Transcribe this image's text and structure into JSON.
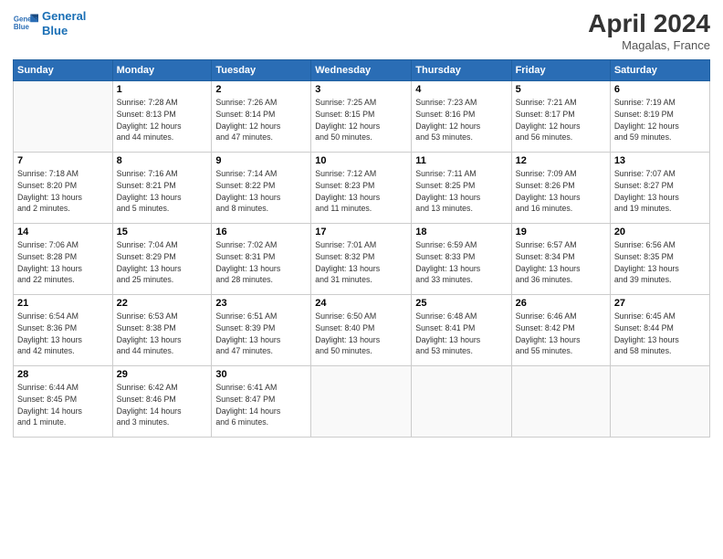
{
  "header": {
    "logo_line1": "General",
    "logo_line2": "Blue",
    "title": "April 2024",
    "location": "Magalas, France"
  },
  "weekdays": [
    "Sunday",
    "Monday",
    "Tuesday",
    "Wednesday",
    "Thursday",
    "Friday",
    "Saturday"
  ],
  "weeks": [
    [
      {
        "day": "",
        "info": ""
      },
      {
        "day": "1",
        "info": "Sunrise: 7:28 AM\nSunset: 8:13 PM\nDaylight: 12 hours\nand 44 minutes."
      },
      {
        "day": "2",
        "info": "Sunrise: 7:26 AM\nSunset: 8:14 PM\nDaylight: 12 hours\nand 47 minutes."
      },
      {
        "day": "3",
        "info": "Sunrise: 7:25 AM\nSunset: 8:15 PM\nDaylight: 12 hours\nand 50 minutes."
      },
      {
        "day": "4",
        "info": "Sunrise: 7:23 AM\nSunset: 8:16 PM\nDaylight: 12 hours\nand 53 minutes."
      },
      {
        "day": "5",
        "info": "Sunrise: 7:21 AM\nSunset: 8:17 PM\nDaylight: 12 hours\nand 56 minutes."
      },
      {
        "day": "6",
        "info": "Sunrise: 7:19 AM\nSunset: 8:19 PM\nDaylight: 12 hours\nand 59 minutes."
      }
    ],
    [
      {
        "day": "7",
        "info": "Sunrise: 7:18 AM\nSunset: 8:20 PM\nDaylight: 13 hours\nand 2 minutes."
      },
      {
        "day": "8",
        "info": "Sunrise: 7:16 AM\nSunset: 8:21 PM\nDaylight: 13 hours\nand 5 minutes."
      },
      {
        "day": "9",
        "info": "Sunrise: 7:14 AM\nSunset: 8:22 PM\nDaylight: 13 hours\nand 8 minutes."
      },
      {
        "day": "10",
        "info": "Sunrise: 7:12 AM\nSunset: 8:23 PM\nDaylight: 13 hours\nand 11 minutes."
      },
      {
        "day": "11",
        "info": "Sunrise: 7:11 AM\nSunset: 8:25 PM\nDaylight: 13 hours\nand 13 minutes."
      },
      {
        "day": "12",
        "info": "Sunrise: 7:09 AM\nSunset: 8:26 PM\nDaylight: 13 hours\nand 16 minutes."
      },
      {
        "day": "13",
        "info": "Sunrise: 7:07 AM\nSunset: 8:27 PM\nDaylight: 13 hours\nand 19 minutes."
      }
    ],
    [
      {
        "day": "14",
        "info": "Sunrise: 7:06 AM\nSunset: 8:28 PM\nDaylight: 13 hours\nand 22 minutes."
      },
      {
        "day": "15",
        "info": "Sunrise: 7:04 AM\nSunset: 8:29 PM\nDaylight: 13 hours\nand 25 minutes."
      },
      {
        "day": "16",
        "info": "Sunrise: 7:02 AM\nSunset: 8:31 PM\nDaylight: 13 hours\nand 28 minutes."
      },
      {
        "day": "17",
        "info": "Sunrise: 7:01 AM\nSunset: 8:32 PM\nDaylight: 13 hours\nand 31 minutes."
      },
      {
        "day": "18",
        "info": "Sunrise: 6:59 AM\nSunset: 8:33 PM\nDaylight: 13 hours\nand 33 minutes."
      },
      {
        "day": "19",
        "info": "Sunrise: 6:57 AM\nSunset: 8:34 PM\nDaylight: 13 hours\nand 36 minutes."
      },
      {
        "day": "20",
        "info": "Sunrise: 6:56 AM\nSunset: 8:35 PM\nDaylight: 13 hours\nand 39 minutes."
      }
    ],
    [
      {
        "day": "21",
        "info": "Sunrise: 6:54 AM\nSunset: 8:36 PM\nDaylight: 13 hours\nand 42 minutes."
      },
      {
        "day": "22",
        "info": "Sunrise: 6:53 AM\nSunset: 8:38 PM\nDaylight: 13 hours\nand 44 minutes."
      },
      {
        "day": "23",
        "info": "Sunrise: 6:51 AM\nSunset: 8:39 PM\nDaylight: 13 hours\nand 47 minutes."
      },
      {
        "day": "24",
        "info": "Sunrise: 6:50 AM\nSunset: 8:40 PM\nDaylight: 13 hours\nand 50 minutes."
      },
      {
        "day": "25",
        "info": "Sunrise: 6:48 AM\nSunset: 8:41 PM\nDaylight: 13 hours\nand 53 minutes."
      },
      {
        "day": "26",
        "info": "Sunrise: 6:46 AM\nSunset: 8:42 PM\nDaylight: 13 hours\nand 55 minutes."
      },
      {
        "day": "27",
        "info": "Sunrise: 6:45 AM\nSunset: 8:44 PM\nDaylight: 13 hours\nand 58 minutes."
      }
    ],
    [
      {
        "day": "28",
        "info": "Sunrise: 6:44 AM\nSunset: 8:45 PM\nDaylight: 14 hours\nand 1 minute."
      },
      {
        "day": "29",
        "info": "Sunrise: 6:42 AM\nSunset: 8:46 PM\nDaylight: 14 hours\nand 3 minutes."
      },
      {
        "day": "30",
        "info": "Sunrise: 6:41 AM\nSunset: 8:47 PM\nDaylight: 14 hours\nand 6 minutes."
      },
      {
        "day": "",
        "info": ""
      },
      {
        "day": "",
        "info": ""
      },
      {
        "day": "",
        "info": ""
      },
      {
        "day": "",
        "info": ""
      }
    ]
  ]
}
